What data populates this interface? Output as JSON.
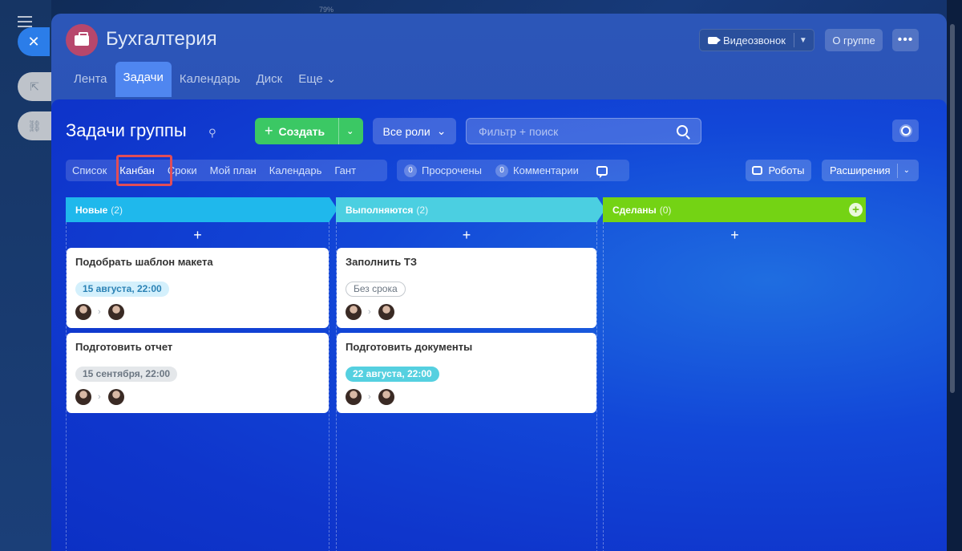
{
  "browser": {
    "zoom_indicator": "79%"
  },
  "app_sidebar": {
    "close_glyph": "✕",
    "icons": [
      "external-link-icon",
      "link-icon",
      "clipboard-icon",
      "chat-icon",
      "calendar-icon",
      "document-icon",
      "card-icon",
      "mail-icon",
      "people-icon",
      "pencil-icon",
      "filter-icon",
      "report-icon",
      "settings-icon"
    ]
  },
  "group": {
    "title": "Бухгалтерия",
    "video_call_label": "Видеозвонок",
    "about_label": "О группе",
    "more_glyph": "•••",
    "tabs": [
      {
        "label": "Лента",
        "active": false
      },
      {
        "label": "Задачи",
        "active": true
      },
      {
        "label": "Календарь",
        "active": false
      },
      {
        "label": "Диск",
        "active": false
      },
      {
        "label": "Еще ⌄",
        "active": false
      }
    ]
  },
  "toolbar": {
    "page_title": "Задачи группы",
    "pin_glyph": "⚲",
    "create_label": "Создать",
    "create_plus": "+",
    "create_chevron": "⌄",
    "roles_label": "Все роли",
    "roles_chevron": "⌄",
    "search_placeholder": "Фильтр + поиск"
  },
  "view_tabs": [
    {
      "label": "Список",
      "active": false
    },
    {
      "label": "Канбан",
      "active": true
    },
    {
      "label": "Сроки",
      "active": false
    },
    {
      "label": "Мой план",
      "active": false
    },
    {
      "label": "Календарь",
      "active": false
    },
    {
      "label": "Гант",
      "active": false
    }
  ],
  "counters": {
    "overdue_count": "0",
    "overdue_label": "Просрочены",
    "comments_count": "0",
    "comments_label": "Комментарии"
  },
  "robots_label": "Роботы",
  "extensions_label": "Расширения",
  "extensions_chevron": "⌄",
  "columns": [
    {
      "title": "Новые",
      "count": "(2)",
      "color": "#1fb8ec",
      "add_glyph": "+",
      "cards": [
        {
          "title": "Подобрать шаблон макета",
          "deadline": "15 августа, 22:00",
          "deadline_style": "blue"
        },
        {
          "title": "Подготовить отчет",
          "deadline": "15 сентября, 22:00",
          "deadline_style": "grey"
        }
      ]
    },
    {
      "title": "Выполняются",
      "count": "(2)",
      "color": "#4bcfe1",
      "add_glyph": "+",
      "cards": [
        {
          "title": "Заполнить ТЗ",
          "deadline": "Без срока",
          "deadline_style": "none"
        },
        {
          "title": "Подготовить документы",
          "deadline": "22 августа, 22:00",
          "deadline_style": "teal"
        }
      ]
    },
    {
      "title": "Сделаны",
      "count": "(0)",
      "color": "#74d314",
      "add_glyph": "+",
      "cards": []
    }
  ],
  "card_arrow_glyph": "›"
}
